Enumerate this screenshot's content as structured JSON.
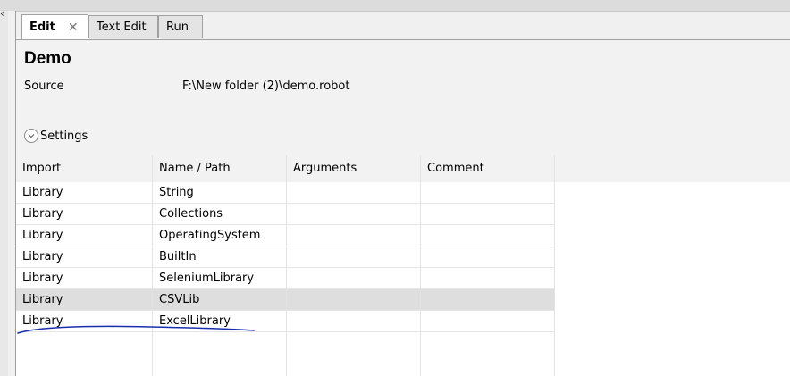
{
  "tabs": [
    {
      "label": "Edit"
    },
    {
      "label": "Text Edit"
    },
    {
      "label": "Run"
    }
  ],
  "suite": {
    "title": "Demo",
    "source_label": "Source",
    "source_value": "F:\\New folder (2)\\demo.robot",
    "settings_label": "Settings"
  },
  "table": {
    "columns": [
      "Import",
      "Name / Path",
      "Arguments",
      "Comment"
    ],
    "rows": [
      {
        "import": "Library",
        "name": "String",
        "arguments": "",
        "comment": ""
      },
      {
        "import": "Library",
        "name": "Collections",
        "arguments": "",
        "comment": ""
      },
      {
        "import": "Library",
        "name": "OperatingSystem",
        "arguments": "",
        "comment": ""
      },
      {
        "import": "Library",
        "name": "BuiltIn",
        "arguments": "",
        "comment": ""
      },
      {
        "import": "Library",
        "name": "SeleniumLibrary",
        "arguments": "",
        "comment": ""
      },
      {
        "import": "Library",
        "name": "CSVLib",
        "arguments": "",
        "comment": ""
      },
      {
        "import": "Library",
        "name": "ExcelLibrary",
        "arguments": "",
        "comment": ""
      }
    ],
    "selected_row": 5
  },
  "colors": {
    "highlight": "#dedede",
    "annotation_pen": "#1a2fb0"
  }
}
